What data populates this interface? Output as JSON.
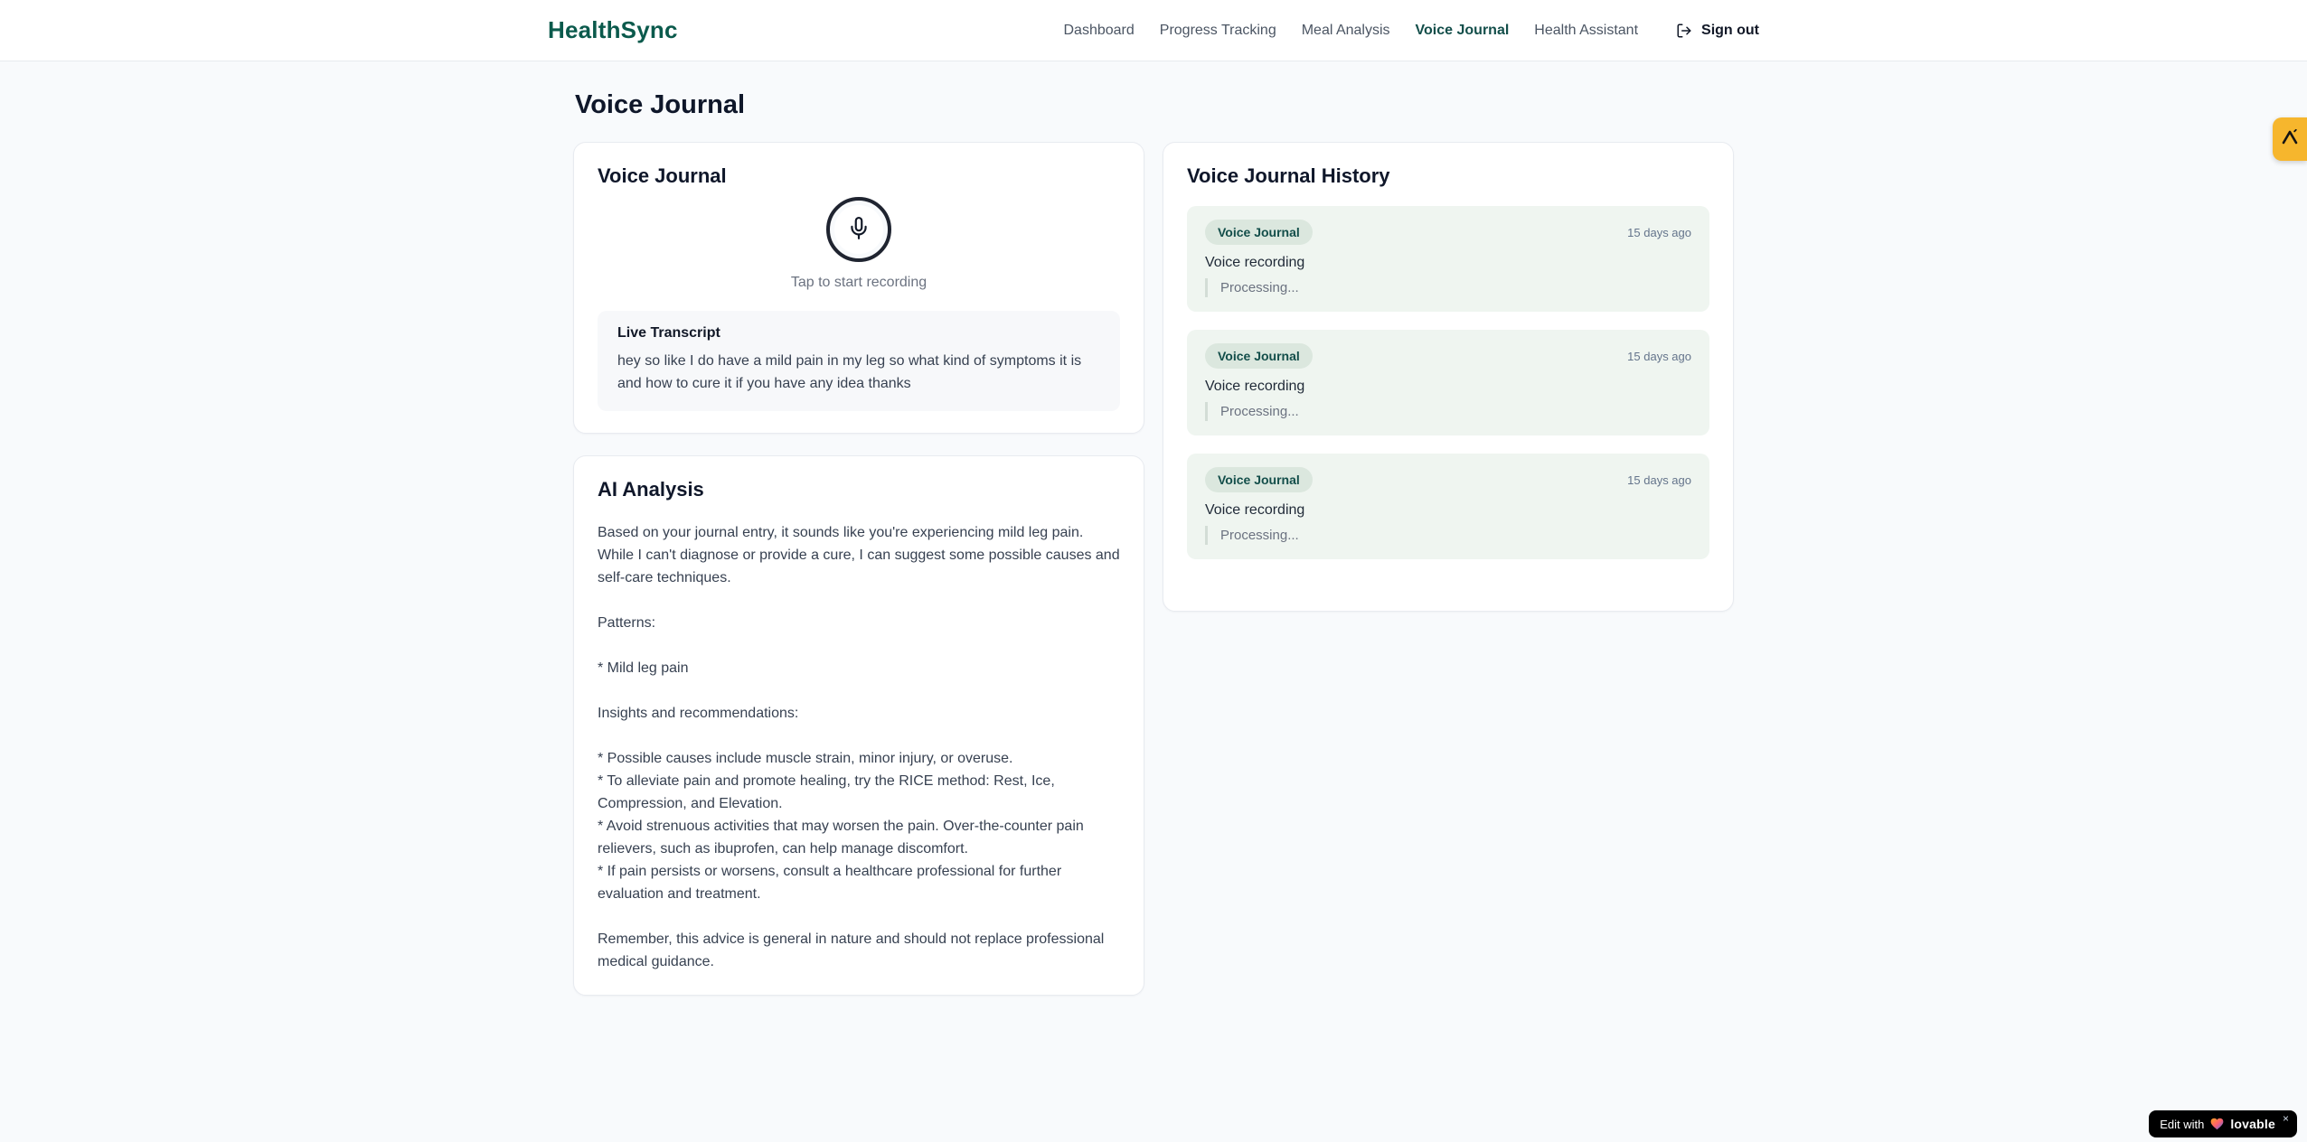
{
  "brand": "HealthSync",
  "nav": {
    "items": [
      {
        "label": "Dashboard",
        "active": false
      },
      {
        "label": "Progress Tracking",
        "active": false
      },
      {
        "label": "Meal Analysis",
        "active": false
      },
      {
        "label": "Voice Journal",
        "active": true
      },
      {
        "label": "Health Assistant",
        "active": false
      }
    ],
    "sign_out_label": "Sign out",
    "sign_out_icon": "logout-icon"
  },
  "page": {
    "title": "Voice Journal"
  },
  "recorder": {
    "card_title": "Voice Journal",
    "mic_icon": "microphone-icon",
    "tap_hint": "Tap to start recording",
    "transcript_title": "Live Transcript",
    "transcript_text": "hey so like I do have a mild pain in my leg so what kind of symptoms it is and how to cure it if you have any idea thanks"
  },
  "analysis": {
    "card_title": "AI Analysis",
    "body": "Based on your journal entry, it sounds like you're experiencing mild leg pain. While I can't diagnose or provide a cure, I can suggest some possible causes and self-care techniques.\n\nPatterns:\n\n* Mild leg pain\n\nInsights and recommendations:\n\n* Possible causes include muscle strain, minor injury, or overuse.\n* To alleviate pain and promote healing, try the RICE method: Rest, Ice, Compression, and Elevation.\n* Avoid strenuous activities that may worsen the pain. Over-the-counter pain relievers, such as ibuprofen, can help manage discomfort.\n* If pain persists or worsens, consult a healthcare professional for further evaluation and treatment.\n\nRemember, this advice is general in nature and should not replace professional medical guidance."
  },
  "history": {
    "card_title": "Voice Journal History",
    "entries": [
      {
        "badge": "Voice Journal",
        "time": "15 days ago",
        "title": "Voice recording",
        "status": "Processing..."
      },
      {
        "badge": "Voice Journal",
        "time": "15 days ago",
        "title": "Voice recording",
        "status": "Processing..."
      },
      {
        "badge": "Voice Journal",
        "time": "15 days ago",
        "title": "Voice recording",
        "status": "Processing..."
      }
    ]
  },
  "overlays": {
    "lovable": {
      "prefix": "Edit with",
      "brand": "lovable",
      "close": "×",
      "heart_icon": "heart-icon"
    },
    "side_tab": {
      "icon": "lambda-logo-icon"
    }
  },
  "colors": {
    "brand_teal": "#0b5a4c",
    "nav_active": "#134e4a",
    "page_background": "#f8fafc",
    "entry_background": "#eff5f0",
    "badge_background": "#dbe7de",
    "badge_text": "#134e4a",
    "side_tab_amber": "#f6b62d",
    "lovable_black": "#000000"
  }
}
